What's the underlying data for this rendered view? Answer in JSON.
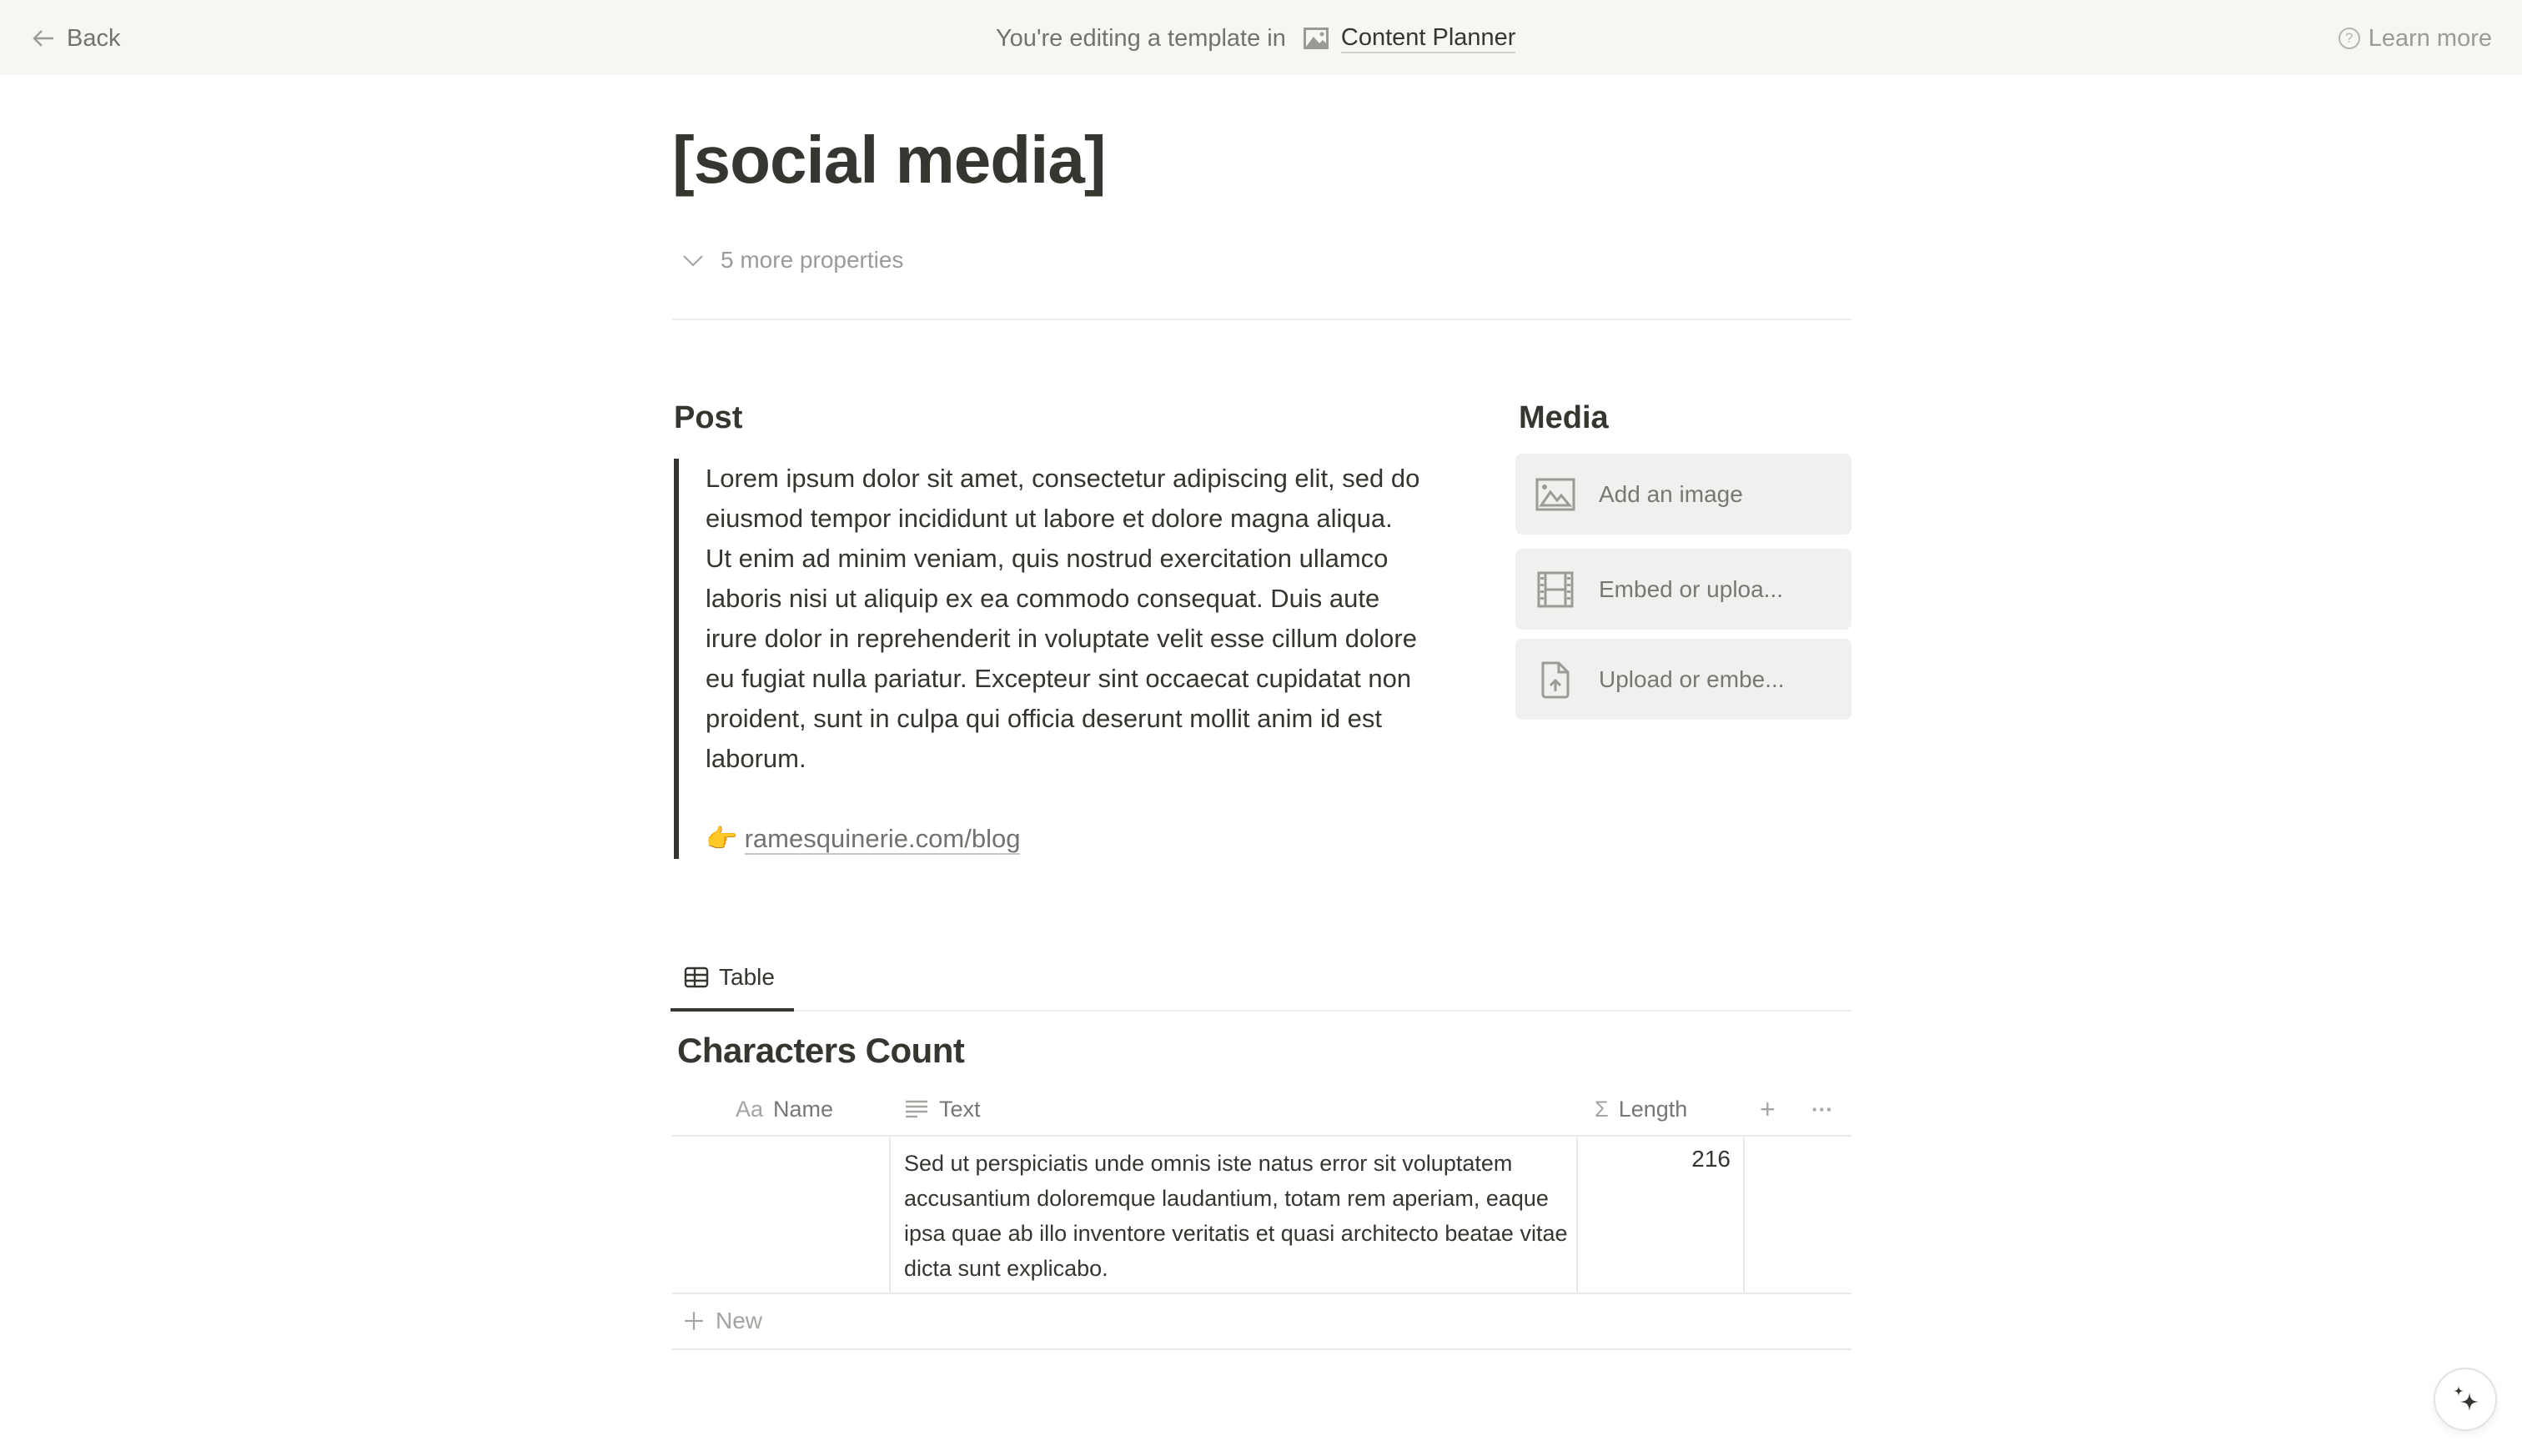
{
  "topbar": {
    "back_label": "Back",
    "editing_prefix": "You're editing a template in",
    "database_name": "Content Planner",
    "learn_more_label": "Learn more"
  },
  "page": {
    "title": "[social media]",
    "more_properties_label": "5 more properties"
  },
  "post": {
    "heading": "Post",
    "body": "Lorem ipsum dolor sit amet, consectetur adipiscing elit, sed do eiusmod tempor incididunt ut labore et dolore magna aliqua. Ut enim ad minim veniam, quis nostrud exercitation ullamco laboris nisi ut aliquip ex ea commodo consequat. Duis aute irure dolor in reprehenderit in voluptate velit esse cillum dolore eu fugiat nulla pariatur. Excepteur sint occaecat cupidatat non proident, sunt in culpa qui officia deserunt mollit anim id est laborum.",
    "link_emoji": "👉",
    "link_text": "ramesquinerie.com/blog"
  },
  "media": {
    "heading": "Media",
    "items": [
      {
        "icon": "image-icon",
        "label": "Add an image"
      },
      {
        "icon": "film-icon",
        "label": "Embed or uploa..."
      },
      {
        "icon": "file-upload-icon",
        "label": "Upload or embe..."
      }
    ]
  },
  "view": {
    "tab_label": "Table",
    "database_title": "Characters Count",
    "columns": [
      {
        "icon": "Aa",
        "label": "Name"
      },
      {
        "icon": "text-lines-icon",
        "label": "Text"
      },
      {
        "icon": "Σ",
        "label": "Length"
      }
    ],
    "rows": [
      {
        "name": "",
        "text": "Sed ut perspiciatis unde omnis iste natus error sit voluptatem accusantium doloremque laudantium, totam rem aperiam, eaque ipsa quae ab illo inventore veritatis et quasi architecto beatae vitae dicta sunt explicabo.",
        "length": "216"
      }
    ],
    "new_label": "New",
    "add_column_glyph": "+",
    "more_glyph": "···"
  },
  "colors": {
    "topbar_bg": "#f7f6f3",
    "text": "#37352f",
    "muted": "#787774",
    "media_bg": "#f1f0ee"
  }
}
